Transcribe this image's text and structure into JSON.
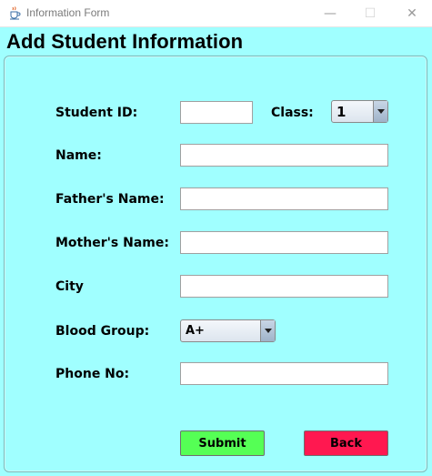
{
  "window": {
    "title": "Information Form",
    "minimize_glyph": "—",
    "maximize_glyph": "☐",
    "close_glyph": "✕"
  },
  "form": {
    "heading": "Add Student Information",
    "student_id": {
      "label": "Student ID:",
      "value": ""
    },
    "class": {
      "label": "Class:",
      "selected": "1"
    },
    "name": {
      "label": "Name:",
      "value": ""
    },
    "father_name": {
      "label": "Father's Name:",
      "value": ""
    },
    "mother_name": {
      "label": "Mother's Name:",
      "value": ""
    },
    "city": {
      "label": "City",
      "value": ""
    },
    "blood_group": {
      "label": "Blood Group:",
      "selected": "A+"
    },
    "phone": {
      "label": "Phone No:",
      "value": ""
    }
  },
  "buttons": {
    "submit": "Submit",
    "back": "Back"
  },
  "colors": {
    "background": "#a0ffff",
    "submit": "#55ff55",
    "back": "#ff1850"
  },
  "icons": {
    "app": "java-cup-icon",
    "minimize": "minimize-icon",
    "maximize": "maximize-icon",
    "close": "close-icon",
    "dropdown": "chevron-down-icon"
  }
}
